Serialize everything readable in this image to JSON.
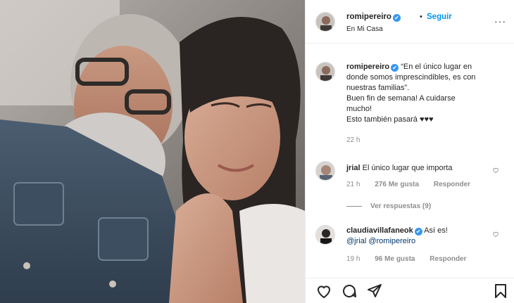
{
  "post": {
    "username": "romipereiro",
    "verified_glyph": "✔",
    "separator": "•",
    "follow_label": "Seguir",
    "location": "En Mi Casa",
    "more_glyph": "···"
  },
  "caption": {
    "username": "romipereiro",
    "lines": [
      "“En el único lugar en",
      "donde somos imprescindibles, es con",
      "nuestras familias”.",
      "Buen fin de semana! A cuidarse",
      "mucho!",
      "Esto también pasará ♥♥♥"
    ],
    "time": "22 h"
  },
  "comments": [
    {
      "username": "jrial",
      "text": "El único lugar que importa",
      "time": "21 h",
      "likes": "276 Me gusta",
      "reply_label": "Responder",
      "view_replies": "Ver respuestas (9)"
    },
    {
      "username": "claudiavillafaneok",
      "text": "Así es!",
      "mention_1": "@jrial",
      "mention_2": "@romipereiro",
      "time": "19 h",
      "likes": "96 Me gusta",
      "reply_label": "Responder"
    }
  ],
  "icons": {
    "like": "heart-icon",
    "comment": "comment-icon",
    "share": "share-icon",
    "save": "bookmark-icon"
  },
  "colors": {
    "accent": "#0095f6",
    "verified": "#3897f0",
    "muted": "#8e8e8e"
  }
}
